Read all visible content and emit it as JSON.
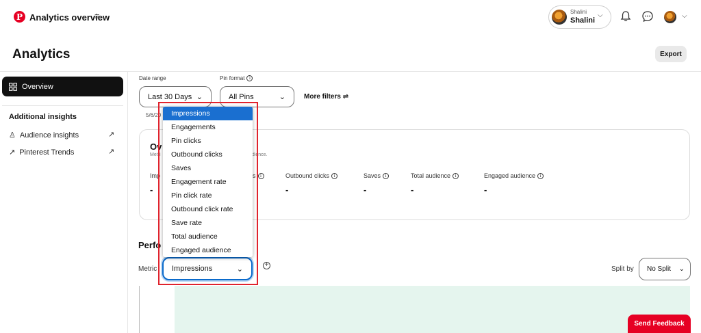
{
  "header": {
    "app_title": "Analytics overview",
    "account_small": "Shalini",
    "account_name": "Shalini"
  },
  "page": {
    "title": "Analytics",
    "export_label": "Export"
  },
  "sidebar": {
    "overview_label": "Overview",
    "additional_title": "Additional insights",
    "links": [
      {
        "label": "Audience insights"
      },
      {
        "label": "Pinterest Trends"
      }
    ]
  },
  "filters": {
    "date_range_label": "Date range",
    "date_range_value": "Last 30 Days",
    "pin_format_label": "Pin format",
    "pin_format_value": "All Pins",
    "more_filters": "More filters",
    "date_hint": "5/6/20"
  },
  "overview": {
    "title": "Ov",
    "sub_left": "Metri",
    "sub_right": "udience.",
    "metrics": [
      {
        "label": "Imp",
        "value": "-"
      },
      {
        "label": "s",
        "value": ""
      },
      {
        "label": "Outbound clicks",
        "value": "-"
      },
      {
        "label": "Saves",
        "value": "-"
      },
      {
        "label": "Total audience",
        "value": "-"
      },
      {
        "label": "Engaged audience",
        "value": "-"
      }
    ]
  },
  "performance": {
    "title": "Perfo",
    "metric_label": "Metric",
    "metric_value": "Impressions",
    "split_label": "Split by",
    "split_value": "No Split"
  },
  "dropdown": {
    "options": [
      "Impressions",
      "Engagements",
      "Pin clicks",
      "Outbound clicks",
      "Saves",
      "Engagement rate",
      "Pin click rate",
      "Outbound click rate",
      "Save rate",
      "Total audience",
      "Engaged audience"
    ],
    "selected_index": 0
  },
  "feedback": {
    "label": "Send Feedback"
  },
  "colors": {
    "brand": "#e60023",
    "selected": "#1a6fd0",
    "highlight": "#e0232d",
    "chart_fill": "#e5f5ee"
  }
}
